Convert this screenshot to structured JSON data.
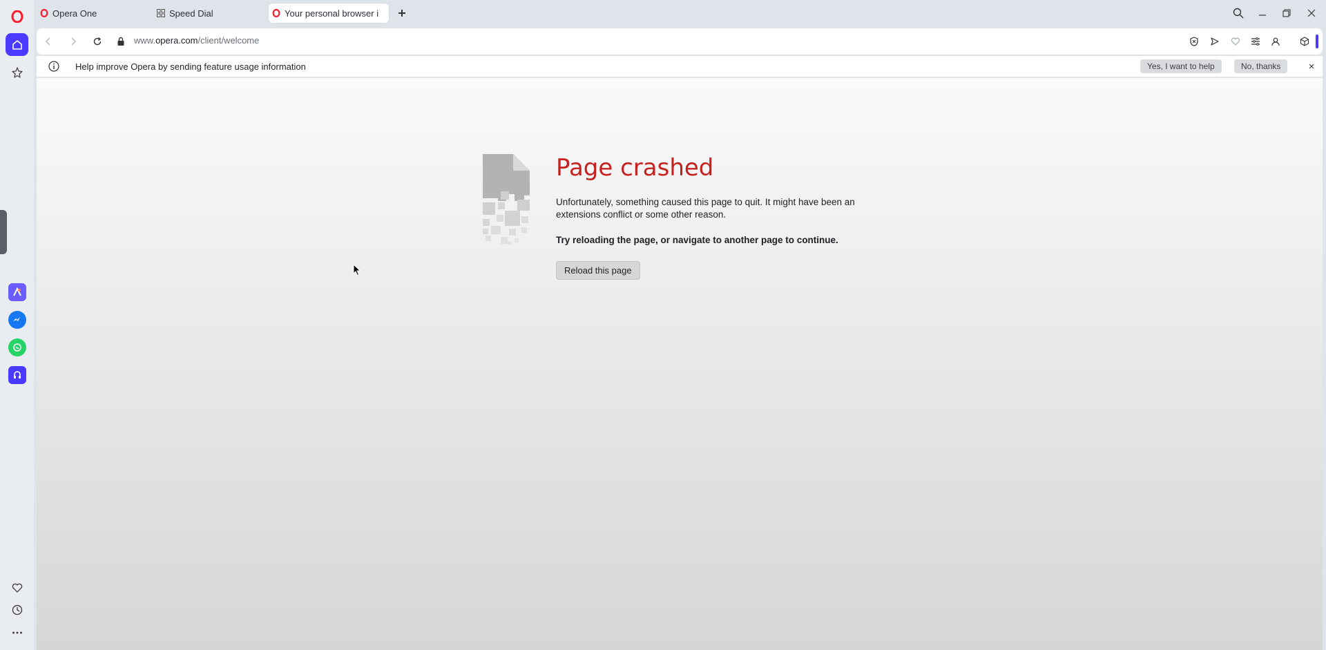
{
  "tabs": [
    {
      "label": "Opera One",
      "icon": "opera-logo-icon"
    },
    {
      "label": "Speed Dial",
      "icon": "speed-dial-icon"
    },
    {
      "label": "Your personal browser i",
      "icon": "opera-logo-icon",
      "active": true
    }
  ],
  "address": {
    "prefix": "www.",
    "host": "opera.com",
    "path": "/client/welcome"
  },
  "infobar": {
    "message": "Help improve Opera by sending feature usage information",
    "accept_label": "Yes, I want to help",
    "decline_label": "No, thanks",
    "close_label": "×"
  },
  "crash": {
    "title": "Page crashed",
    "description": "Unfortunately, something caused this page to quit. It might have been an extensions conflict or some other reason.",
    "hint": "Try reloading the page, or navigate to another page to continue.",
    "reload_label": "Reload this page"
  },
  "colors": {
    "accent": "#4a3aff",
    "opera_red": "#ff1b2d",
    "error_title": "#c5221f"
  }
}
